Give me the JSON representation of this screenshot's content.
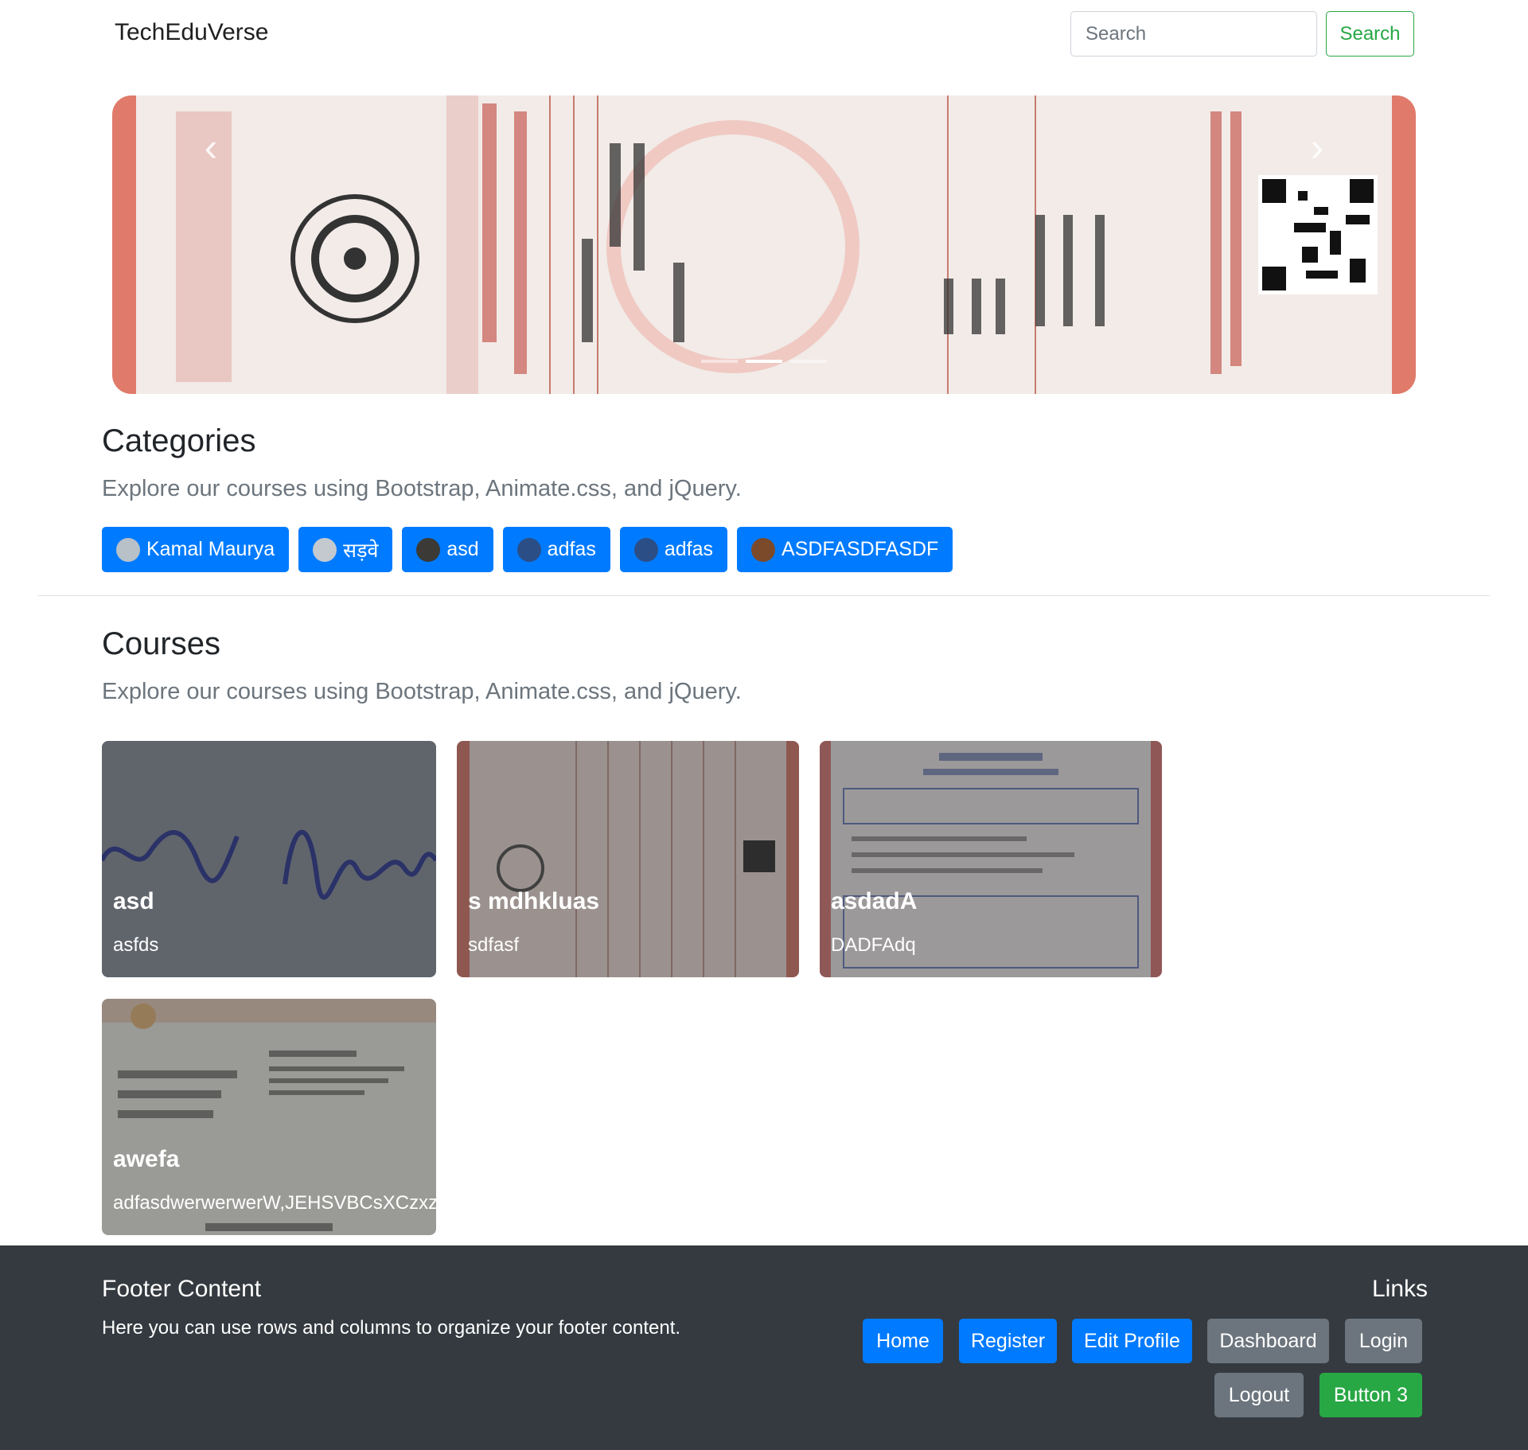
{
  "navbar": {
    "brand": "TechEduVerse",
    "search_placeholder": "Search",
    "search_button": "Search"
  },
  "carousel": {
    "slide_count": 3,
    "active_index": 1
  },
  "categories": {
    "title": "Categories",
    "lead": "Explore our courses using Bootstrap, Animate.css, and jQuery.",
    "items": [
      {
        "label": "Kamal Maurya",
        "avatar_color": "#b8c0c8"
      },
      {
        "label": "सड़वे",
        "avatar_color": "#c4c9cf"
      },
      {
        "label": "asd",
        "avatar_color": "#3b3a36"
      },
      {
        "label": "adfas",
        "avatar_color": "#2c4e86"
      },
      {
        "label": "adfas",
        "avatar_color": "#2c4e86"
      },
      {
        "label": "ASDFASDFASDF",
        "avatar_color": "#7b4a2a"
      }
    ]
  },
  "courses": {
    "title": "Courses",
    "lead": "Explore our courses using Bootstrap, Animate.css, and jQuery.",
    "cards": [
      {
        "title": "asd",
        "text": "asfds"
      },
      {
        "title": "s mdhkluas",
        "text": "sdfasf"
      },
      {
        "title": "asdadA",
        "text": "DADFAdq"
      },
      {
        "title": "awefa",
        "text": "adfasdwerwerwerW,JEHSVBCsXCzxzx"
      }
    ]
  },
  "footer": {
    "title": "Footer Content",
    "text": "Here you can use rows and columns to organize your footer content.",
    "links_title": "Links",
    "buttons": {
      "home": "Home",
      "register": "Register",
      "edit_profile": "Edit Profile",
      "dashboard": "Dashboard",
      "login": "Login",
      "logout": "Logout",
      "button3": "Button 3"
    }
  }
}
